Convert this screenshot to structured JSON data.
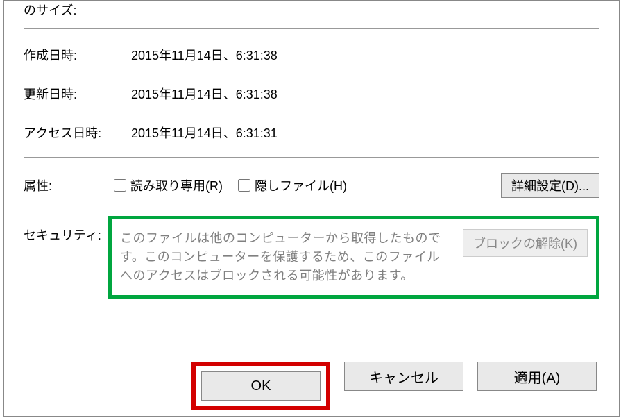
{
  "size_label_partial": "のサイズ:",
  "fields": {
    "created": {
      "label": "作成日時:",
      "value": "2015年11月14日、6:31:38"
    },
    "modified": {
      "label": "更新日時:",
      "value": "2015年11月14日、6:31:38"
    },
    "accessed": {
      "label": "アクセス日時:",
      "value": "2015年11月14日、6:31:31"
    }
  },
  "attributes": {
    "label": "属性:",
    "readonly": "読み取り専用(R)",
    "hidden": "隠しファイル(H)",
    "advanced": "詳細設定(D)..."
  },
  "security": {
    "label": "セキュリティ:",
    "text": "このファイルは他のコンピューターから取得したものです。このコンピューターを保護するため、このファイルへのアクセスはブロックされる可能性があります。",
    "unblock": "ブロックの解除(K)"
  },
  "buttons": {
    "ok": "OK",
    "cancel": "キャンセル",
    "apply": "適用(A)"
  },
  "highlight_colors": {
    "green": "#00a63f",
    "red": "#d30000"
  }
}
